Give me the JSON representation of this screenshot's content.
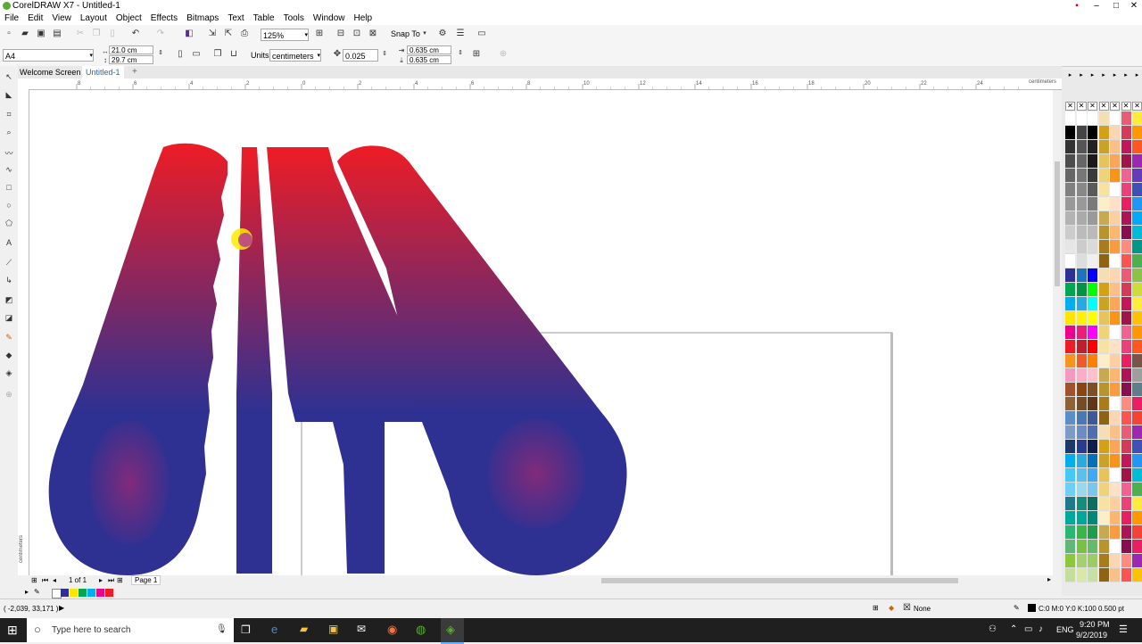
{
  "window": {
    "title": "CorelDRAW X7 - Untitled-1"
  },
  "menu": [
    "File",
    "Edit",
    "View",
    "Layout",
    "Object",
    "Effects",
    "Bitmaps",
    "Text",
    "Table",
    "Tools",
    "Window",
    "Help"
  ],
  "toolbar": {
    "zoom": "125%",
    "snap_to": "Snap To"
  },
  "propbar": {
    "page_size": "A4",
    "width": "21.0 cm",
    "height": "29.7 cm",
    "units_label": "Units:",
    "units_value": "centimeters",
    "nudge": "0.025 cm",
    "dup_x": "0.635 cm",
    "dup_y": "0.635 cm"
  },
  "tabs": [
    {
      "label": "Welcome Screen"
    },
    {
      "label": "Untitled-1"
    }
  ],
  "ruler": {
    "h_ticks": [
      "8",
      "6",
      "4",
      "2",
      "0",
      "2",
      "4",
      "6",
      "8",
      "10",
      "12",
      "14",
      "16",
      "18",
      "20",
      "22",
      "24"
    ],
    "unit": "centimeters",
    "v_unit": "centimeters"
  },
  "pagenav": {
    "page_of": "1 of 1",
    "page_tab": "Page 1"
  },
  "status": {
    "coords": "( -2,039, 33,171 )",
    "fill_none": "None",
    "outline_info": "C:0 M:0 Y:0 K:100  0.500 pt"
  },
  "taskbar": {
    "search_placeholder": "Type here to search",
    "time": "9:20 PM",
    "date": "9/2/2019",
    "lang": "ENG"
  },
  "colors": {
    "gradient_top": "#ee1c25",
    "gradient_bottom": "#2e3192",
    "accent": "#2e3192"
  }
}
